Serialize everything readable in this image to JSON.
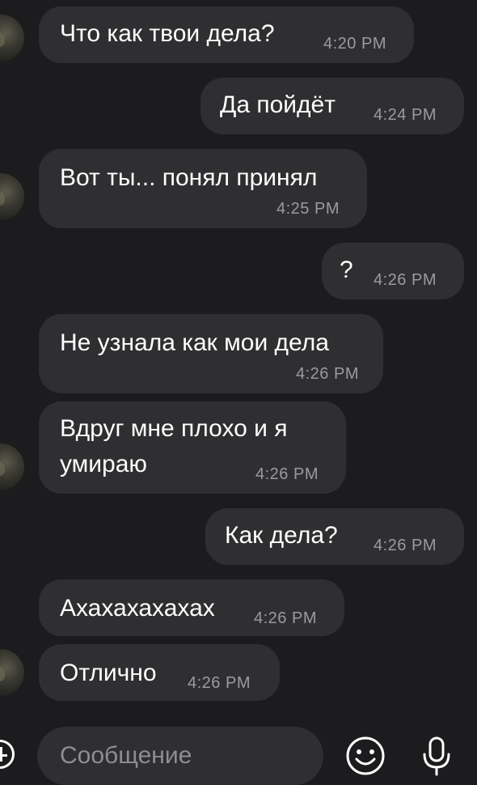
{
  "messages": [
    {
      "side": "in",
      "text": "Что как твои дела?",
      "time": "4:20 PM"
    },
    {
      "side": "out",
      "text": "Да пойдёт",
      "time": "4:24 PM"
    },
    {
      "side": "in",
      "text": "Вот ты... понял принял",
      "time": "4:25 PM"
    },
    {
      "side": "out",
      "text": "?",
      "time": "4:26 PM"
    },
    {
      "side": "in",
      "text": "Не узнала как мои дела",
      "time": "4:26 PM"
    },
    {
      "side": "in",
      "text_line1": "Вдруг мне плохо и я",
      "text_line2": "умираю",
      "time": "4:26 PM"
    },
    {
      "side": "out",
      "text": "Как дела?",
      "time": "4:26 PM"
    },
    {
      "side": "in",
      "text": "Ахахахахахах",
      "time": "4:26 PM"
    },
    {
      "side": "in",
      "text": "Отлично",
      "time": "4:26 PM"
    }
  ],
  "composer": {
    "placeholder": "Сообщение",
    "add_icon": "plus-circle-icon",
    "emoji_icon": "smiley-icon",
    "mic_icon": "microphone-icon"
  },
  "colors": {
    "background": "#1c1c1e",
    "bubble": "#2f2f31",
    "text": "#ffffff",
    "timestamp": "#9b9b9f"
  }
}
